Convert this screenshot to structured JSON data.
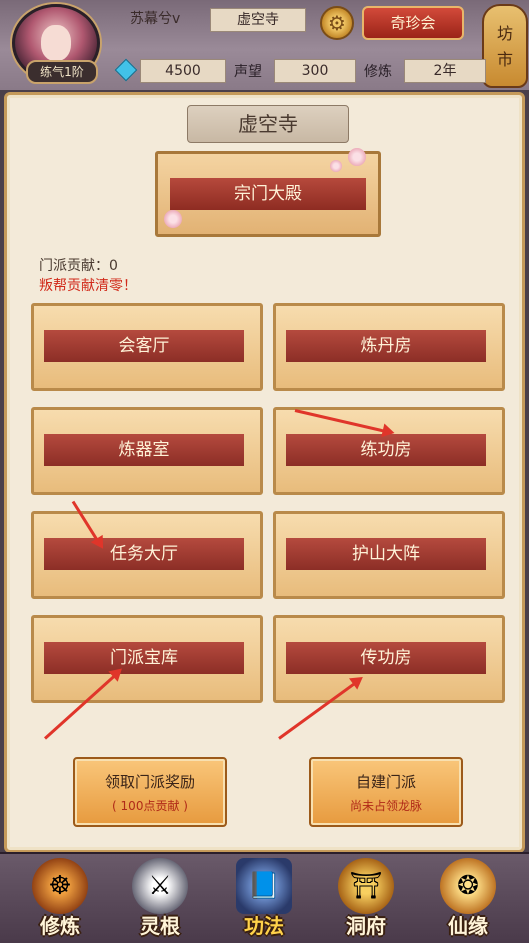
{
  "header": {
    "level_badge": "练气1阶",
    "player_name": "苏幕兮v",
    "location": "虚空寺",
    "treasure_button": "奇珍会",
    "market_label_top": "坊",
    "market_label_bottom": "市",
    "jade_value": "4500",
    "reputation_label": "声望",
    "reputation_value": "300",
    "cultivation_label": "修炼",
    "cultivation_value": "2年"
  },
  "panel": {
    "title": "虚空寺",
    "main_hall": "宗门大殿",
    "contribution": "门派贡献：0",
    "warning": "叛帮贡献清零！",
    "rooms": [
      "会客厅",
      "炼丹房",
      "炼器室",
      "练功房",
      "任务大厅",
      "护山大阵",
      "门派宝库",
      "传功房"
    ],
    "claim_button": {
      "title": "领取门派奖励",
      "subtitle": "( 100点贡献 )"
    },
    "create_button": {
      "title": "自建门派",
      "subtitle": "尚未占领龙脉"
    }
  },
  "nav": {
    "items": [
      {
        "label": "修炼",
        "icon": "monk-icon"
      },
      {
        "label": "灵根",
        "icon": "sword-icon"
      },
      {
        "label": "功法",
        "icon": "book-icon"
      },
      {
        "label": "洞府",
        "icon": "palace-icon"
      },
      {
        "label": "仙缘",
        "icon": "gourd-icon"
      }
    ],
    "active_index": 2
  },
  "colors": {
    "accent_red": "#b54a3e",
    "warning_red": "#d12a1a",
    "parchment": "#f3ead9",
    "arrow_red": "#e0352a"
  }
}
